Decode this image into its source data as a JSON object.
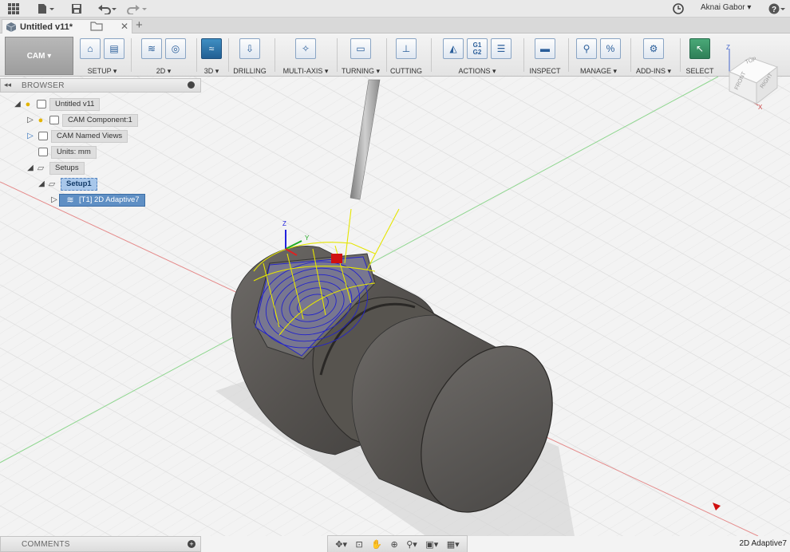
{
  "appbar": {
    "user_name": "Aknai Gabor",
    "help_label": "?"
  },
  "tabs": {
    "doc_title": "Untitled v11*"
  },
  "ribbon": {
    "workspace_label": "CAM",
    "groups": [
      {
        "label": "SETUP",
        "caret": true
      },
      {
        "label": "2D",
        "caret": true
      },
      {
        "label": "3D",
        "caret": true
      },
      {
        "label": "DRILLING",
        "caret": false
      },
      {
        "label": "MULTI-AXIS",
        "caret": true
      },
      {
        "label": "TURNING",
        "caret": true
      },
      {
        "label": "CUTTING",
        "caret": false
      },
      {
        "label": "ACTIONS",
        "caret": true
      },
      {
        "label": "INSPECT",
        "caret": false
      },
      {
        "label": "MANAGE",
        "caret": true
      },
      {
        "label": "ADD-INS",
        "caret": true
      },
      {
        "label": "SELECT",
        "caret": false
      }
    ],
    "gcode_icon_text": "G1\nG2"
  },
  "browser": {
    "title": "BROWSER",
    "root": "Untitled v11",
    "component": "CAM Component:1",
    "named_views": "CAM Named Views",
    "units": "Units: mm",
    "setups": "Setups",
    "setup1": "Setup1",
    "operation": "[T1] 2D Adaptive7"
  },
  "viewcube": {
    "top": "TOP",
    "front": "FRONT",
    "right": "RIGHT",
    "axis_x": "X",
    "axis_z": "Z"
  },
  "triad": {
    "x": "X",
    "y": "Y",
    "z": "Z"
  },
  "comments": {
    "title": "COMMENTS",
    "add": "+"
  },
  "status": {
    "text": "2D Adaptive7"
  },
  "colors": {
    "accent": "#5f8fc4",
    "toolpath": "#2222cc",
    "stock": "#e5e500",
    "axis_x": "#d9534f",
    "axis_y": "#5cb85c"
  }
}
